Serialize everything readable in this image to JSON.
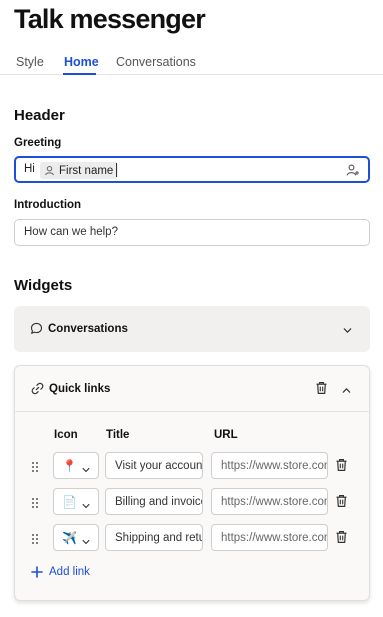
{
  "app": {
    "title": "Talk messenger"
  },
  "tabs": [
    {
      "label": "Style",
      "active": false
    },
    {
      "label": "Home",
      "active": true
    },
    {
      "label": "Conversations",
      "active": false
    }
  ],
  "header_section": {
    "heading": "Header",
    "greeting": {
      "label": "Greeting",
      "prefix": "Hi",
      "token_label": "First name",
      "token_icon": "person-icon",
      "action_icon": "add-person-icon"
    },
    "introduction": {
      "label": "Introduction",
      "value": "How can we help?"
    }
  },
  "widgets": {
    "heading": "Widgets",
    "conversations_panel": {
      "title": "Conversations",
      "icon": "chat-bubble-icon",
      "expanded": false
    },
    "quick_links_panel": {
      "title": "Quick links",
      "icon": "link-icon",
      "expanded": true,
      "columns": {
        "icon": "Icon",
        "title": "Title",
        "url": "URL"
      },
      "links": [
        {
          "emoji": "📍",
          "title": "Visit your account",
          "url": "https://www.store.com"
        },
        {
          "emoji": "📄",
          "title": "Billing and invoices",
          "url": "https://www.store.com"
        },
        {
          "emoji": "✈️",
          "title": "Shipping and returns",
          "url": "https://www.store.com"
        }
      ],
      "add_label": "Add link"
    }
  },
  "colors": {
    "accent": "#1d4fd8",
    "panel_bg": "#f1f0ee",
    "text": "#111111"
  }
}
